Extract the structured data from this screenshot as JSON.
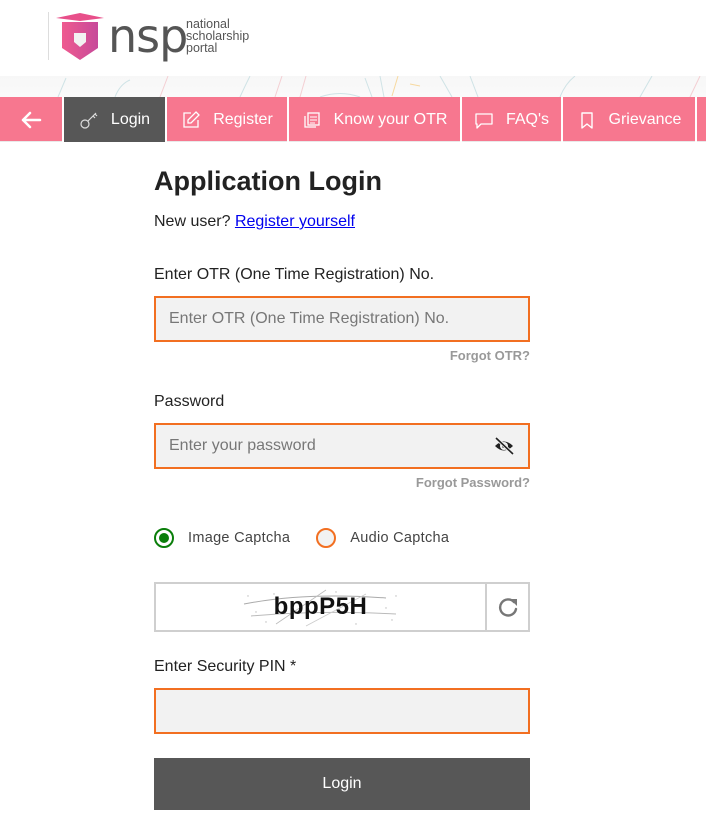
{
  "header": {
    "logo_abbr": "nsp",
    "logo_line1": "national",
    "logo_line2": "scholarship",
    "logo_line3": "portal",
    "brand_pink": "#e84f8a"
  },
  "nav": {
    "back_icon": "arrow-left-icon",
    "items": [
      {
        "label": "Login",
        "icon": "key-icon",
        "active": true
      },
      {
        "label": "Register",
        "icon": "edit-icon",
        "active": false
      },
      {
        "label": "Know your OTR",
        "icon": "document-icon",
        "active": false
      },
      {
        "label": "FAQ's",
        "icon": "chat-bubble-icon",
        "active": false
      },
      {
        "label": "Grievance",
        "icon": "bookmark-icon",
        "active": false
      }
    ],
    "bg_color": "#f7778f",
    "active_color": "#575757"
  },
  "form": {
    "title": "Application Login",
    "new_user_text": "New user?",
    "register_link": "Register yourself",
    "otr_label": "Enter OTR (One Time Registration) No.",
    "otr_placeholder": "Enter OTR (One Time Registration) No.",
    "otr_value": "",
    "forgot_otr": "Forgot OTR?",
    "password_label": "Password",
    "password_placeholder": "Enter your password",
    "password_value": "",
    "password_toggle_icon": "eye-slash-icon",
    "forgot_password": "Forgot Password?",
    "captcha_options": [
      {
        "label": "Image Captcha",
        "selected": true
      },
      {
        "label": "Audio Captcha",
        "selected": false
      }
    ],
    "captcha_text": "bppP5H",
    "refresh_icon": "refresh-icon",
    "pin_label": "Enter Security PIN *",
    "pin_value": "",
    "login_button": "Login",
    "input_border_color": "#f26f21",
    "selected_radio_color": "#0a7e0a"
  }
}
